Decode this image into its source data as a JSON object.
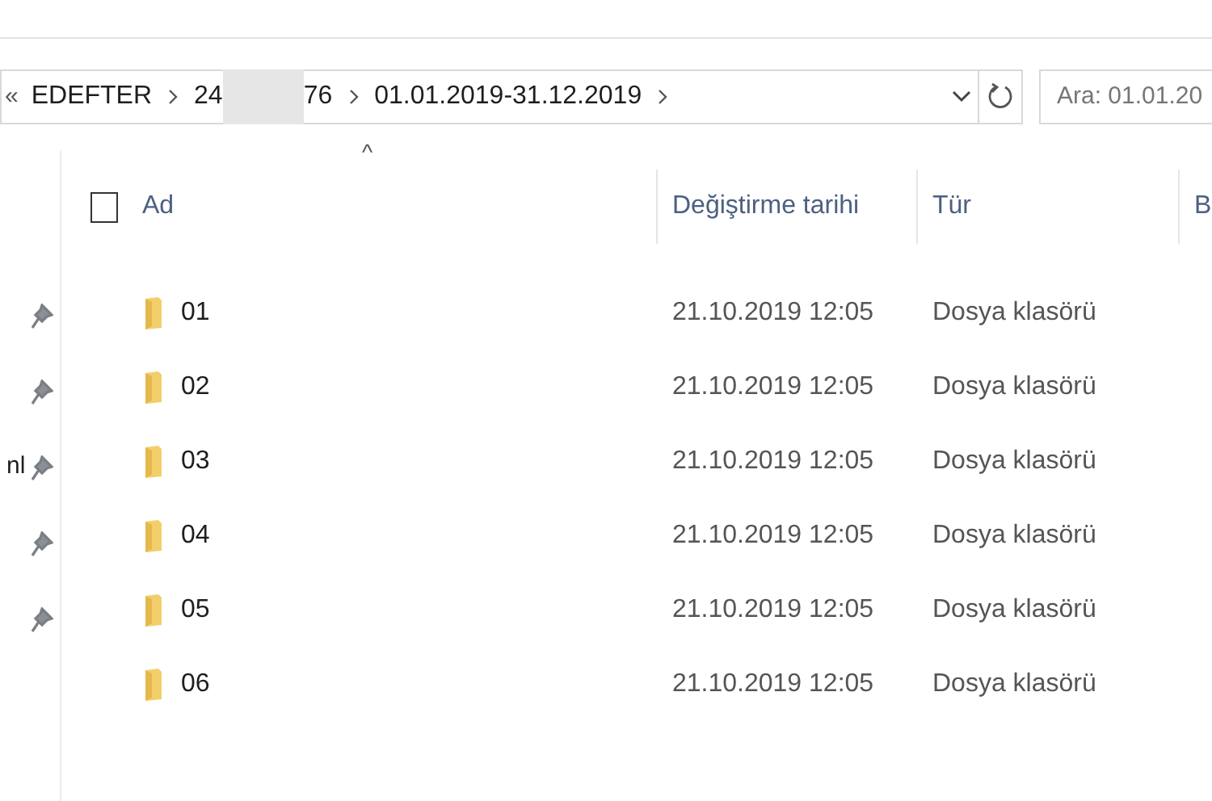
{
  "address_bar": {
    "overflow": "«",
    "crumbs": [
      {
        "parts": [
          "EDEFTER"
        ]
      },
      {
        "parts": [
          "24",
          "76"
        ],
        "redacted": true
      },
      {
        "parts": [
          "01.01.2019-31.12.2019"
        ]
      }
    ]
  },
  "search": {
    "placeholder": "Ara: 01.01.20"
  },
  "sidebar": {
    "items": [
      {
        "pinned": true
      },
      {
        "pinned": true
      },
      {
        "label": "nl",
        "pinned": true
      },
      {
        "pinned": true
      },
      {
        "pinned": true
      }
    ]
  },
  "select_all": {
    "checked": false
  },
  "sort_indicator": "^",
  "columns": [
    {
      "label": "Ad",
      "kind": "name"
    },
    {
      "label": "Değiştirme tarihi",
      "kind": "text"
    },
    {
      "label": "Tür",
      "kind": "text"
    },
    {
      "label": "B",
      "kind": "text"
    }
  ],
  "rows": [
    {
      "name": "01",
      "modified": "21.10.2019 12:05",
      "type": "Dosya klasörü"
    },
    {
      "name": "02",
      "modified": "21.10.2019 12:05",
      "type": "Dosya klasörü"
    },
    {
      "name": "03",
      "modified": "21.10.2019 12:05",
      "type": "Dosya klasörü"
    },
    {
      "name": "04",
      "modified": "21.10.2019 12:05",
      "type": "Dosya klasörü"
    },
    {
      "name": "05",
      "modified": "21.10.2019 12:05",
      "type": "Dosya klasörü"
    },
    {
      "name": "06",
      "modified": "21.10.2019 12:05",
      "type": "Dosya klasörü"
    }
  ]
}
